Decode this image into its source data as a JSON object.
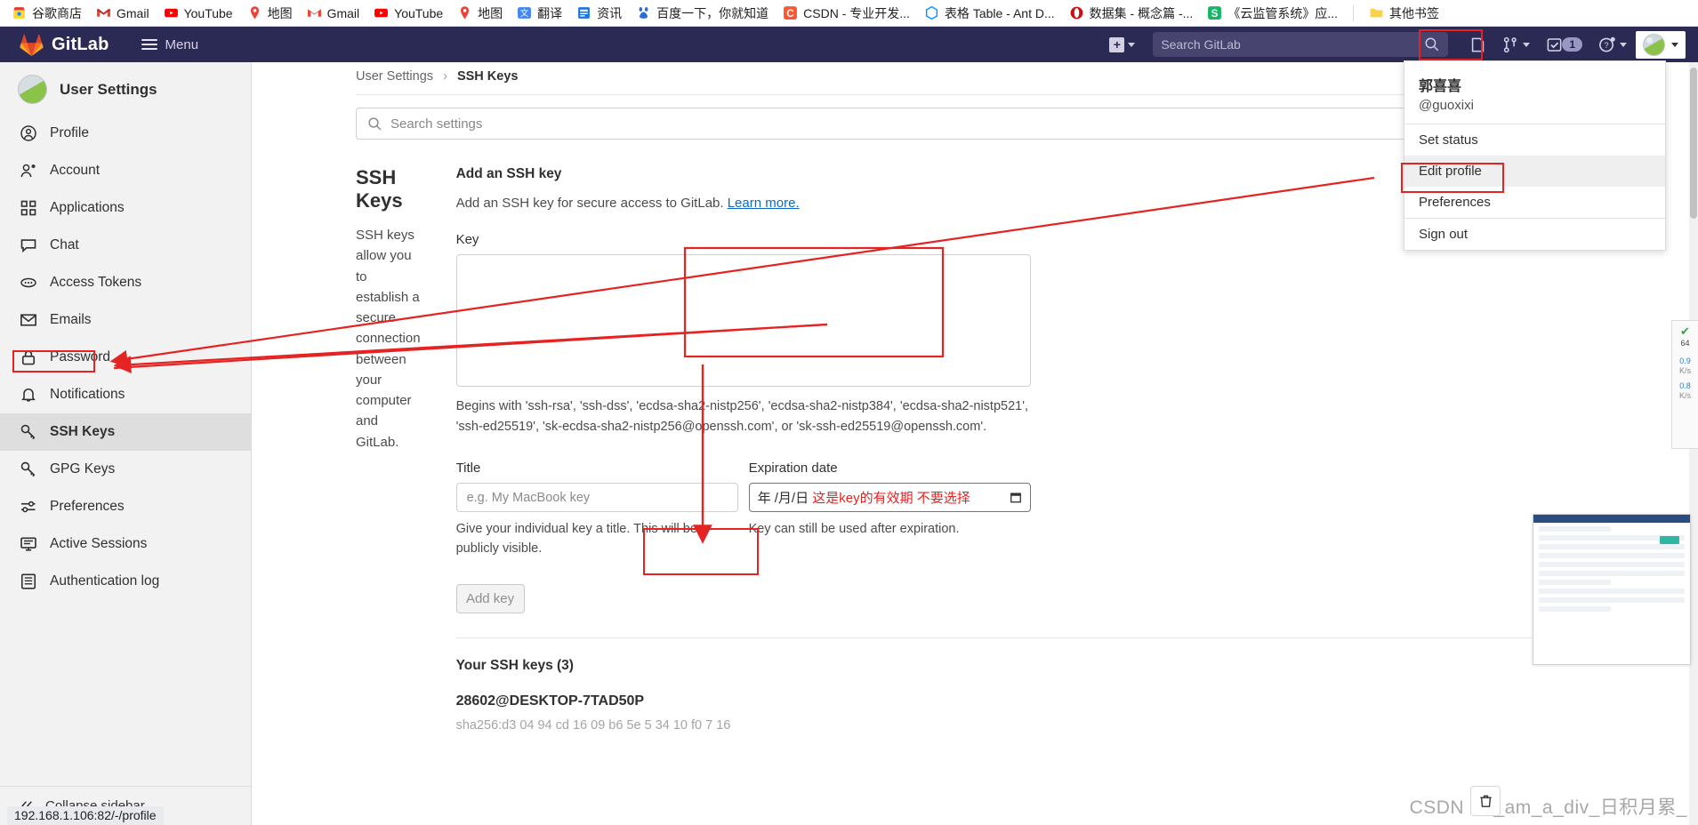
{
  "browser": {
    "bookmarks": [
      {
        "label": "谷歌商店",
        "icon": "chrome-store-icon"
      },
      {
        "label": "Gmail",
        "icon": "gmail-icon"
      },
      {
        "label": "YouTube",
        "icon": "youtube-icon"
      },
      {
        "label": "地图",
        "icon": "maps-icon"
      },
      {
        "label": "Gmail",
        "icon": "gmail-icon"
      },
      {
        "label": "YouTube",
        "icon": "youtube-icon"
      },
      {
        "label": "地图",
        "icon": "maps-icon"
      },
      {
        "label": "翻译",
        "icon": "translate-icon"
      },
      {
        "label": "资讯",
        "icon": "news-icon"
      },
      {
        "label": "百度一下，你就知道",
        "icon": "baidu-icon"
      },
      {
        "label": "CSDN - 专业开发...",
        "icon": "csdn-icon"
      },
      {
        "label": "表格 Table - Ant D...",
        "icon": "antd-icon"
      },
      {
        "label": "数据集 - 概念篇 -...",
        "icon": "opera-icon"
      },
      {
        "label": "《云监管系统》应...",
        "icon": "wps-icon"
      }
    ],
    "other_bookmarks": {
      "label": "其他书签",
      "icon": "folder-icon"
    },
    "status_url": "192.168.1.106:82/-/profile"
  },
  "navbar": {
    "brand": "GitLab",
    "menu_label": "Menu",
    "create_new_icon": "plus-icon",
    "search_placeholder": "Search GitLab",
    "search_icon": "magnifier-icon",
    "issues_icon": "issues-icon",
    "merge_requests_icon": "merge-request-icon",
    "todos_icon": "todo-checkbox-icon",
    "todos_count": "1",
    "help_icon": "question-circle-icon",
    "avatar_icon": "user-avatar-icon"
  },
  "profile_menu": {
    "name": "郭喜喜",
    "handle": "@guoxixi",
    "items": [
      {
        "label": "Set status",
        "highlighted": false
      },
      {
        "label": "Edit profile",
        "highlighted": true
      },
      {
        "label": "Preferences",
        "highlighted": false
      },
      {
        "label": "Sign out",
        "highlighted": false
      }
    ]
  },
  "sidebar": {
    "title": "User Settings",
    "items": [
      {
        "label": "Profile",
        "icon": "user-circle-icon",
        "active": false
      },
      {
        "label": "Account",
        "icon": "account-icon",
        "active": false
      },
      {
        "label": "Applications",
        "icon": "applications-grid-icon",
        "active": false
      },
      {
        "label": "Chat",
        "icon": "chat-bubble-icon",
        "active": false
      },
      {
        "label": "Access Tokens",
        "icon": "token-icon",
        "active": false
      },
      {
        "label": "Emails",
        "icon": "envelope-icon",
        "active": false
      },
      {
        "label": "Password",
        "icon": "lock-icon",
        "active": false
      },
      {
        "label": "Notifications",
        "icon": "bell-icon",
        "active": false
      },
      {
        "label": "SSH Keys",
        "icon": "key-icon",
        "active": true
      },
      {
        "label": "GPG Keys",
        "icon": "key-icon",
        "active": false
      },
      {
        "label": "Preferences",
        "icon": "sliders-icon",
        "active": false
      },
      {
        "label": "Active Sessions",
        "icon": "monitor-icon",
        "active": false
      },
      {
        "label": "Authentication log",
        "icon": "log-list-icon",
        "active": false
      }
    ],
    "collapse_label": "Collapse sidebar",
    "collapse_icon": "chevron-double-left-icon"
  },
  "breadcrumb": {
    "root": "User Settings",
    "separator": "›",
    "current": "SSH Keys"
  },
  "settings_search": {
    "placeholder": "Search settings",
    "icon": "magnifier-icon"
  },
  "ssh_section": {
    "heading": "SSH Keys",
    "description": "SSH keys allow you to establish a secure connection between your computer and GitLab.",
    "form_title": "Add an SSH key",
    "form_lede": "Add an SSH key for secure access to GitLab.",
    "form_lede_link": "Learn more.",
    "key_label": "Key",
    "key_value": "",
    "key_hint": "Begins with 'ssh-rsa', 'ssh-dss', 'ecdsa-sha2-nistp256', 'ecdsa-sha2-nistp384', 'ecdsa-sha2-nistp521', 'ssh-ed25519', 'sk-ecdsa-sha2-nistp256@openssh.com', or 'sk-ssh-ed25519@openssh.com'.",
    "title_label": "Title",
    "title_placeholder": "e.g. My MacBook key",
    "title_help": "Give your individual key a title. This will be publicly visible.",
    "expiration_label": "Expiration date",
    "expiration_placeholder": "年 /月/日",
    "expiration_annotation": "这是key的有效期 不要选择",
    "expiration_calendar_icon": "calendar-icon",
    "expiration_help": "Key can still be used after expiration.",
    "submit_label": "Add key"
  },
  "keys_list": {
    "heading": "Your SSH keys (3)",
    "first_key_title": "28602@DESKTOP-7TAD50P",
    "first_key_meta": "sha256:d3 04 94 cd 16 09 b6 5e  5 34 10 f0  7 16"
  },
  "widgets": {
    "speed_check_icon": "check-circle-icon",
    "speed_value": "64",
    "speed_up": "0.9",
    "speed_up_unit": "K/s",
    "speed_down": "0.8",
    "speed_down_unit": "K/s",
    "trash_icon": "trash-icon",
    "watermark": "CSDN @i_am_a_div_日积月累_"
  },
  "colors": {
    "gitlab_navy": "#2b2a54",
    "annotation_red": "#e52322",
    "link_blue": "#1068bf",
    "sidebar_bg": "#f2f2f2"
  }
}
